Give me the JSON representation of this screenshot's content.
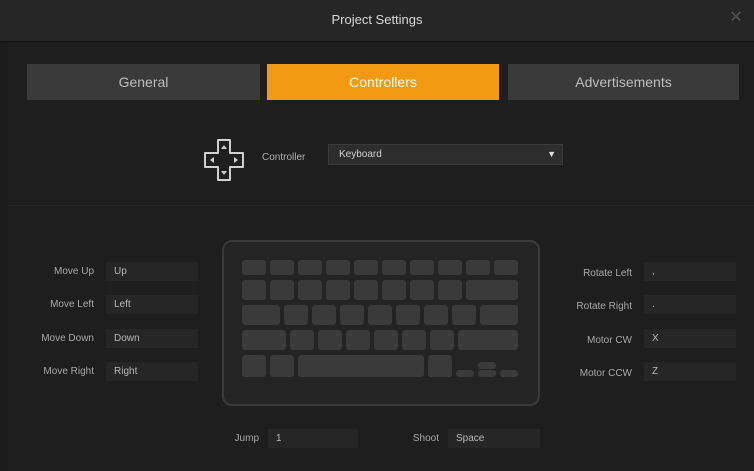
{
  "window": {
    "title": "Project Settings",
    "close_glyph": "✕"
  },
  "tabs": [
    {
      "label": "General",
      "active": false
    },
    {
      "label": "Controllers",
      "active": true
    },
    {
      "label": "Advertisements",
      "active": false
    }
  ],
  "controller": {
    "label": "Controller",
    "selected": "Keyboard",
    "icon": "dpad-icon"
  },
  "left_bindings": [
    {
      "action": "Move Up",
      "key": "Up"
    },
    {
      "action": "Move Left",
      "key": "Left"
    },
    {
      "action": "Move Down",
      "key": "Down"
    },
    {
      "action": "Move Right",
      "key": "Right"
    }
  ],
  "right_bindings": [
    {
      "action": "Rotate Left",
      "key": ","
    },
    {
      "action": "Rotate Right",
      "key": "."
    },
    {
      "action": "Motor CW",
      "key": "X"
    },
    {
      "action": "Motor CCW",
      "key": "Z"
    }
  ],
  "bottom_bindings": [
    {
      "action": "Jump",
      "key": "1"
    },
    {
      "action": "Shoot",
      "key": "Space"
    }
  ],
  "colors": {
    "accent": "#f29a12",
    "background": "#1b1b1b",
    "tab_inactive": "#3a3a3a"
  }
}
